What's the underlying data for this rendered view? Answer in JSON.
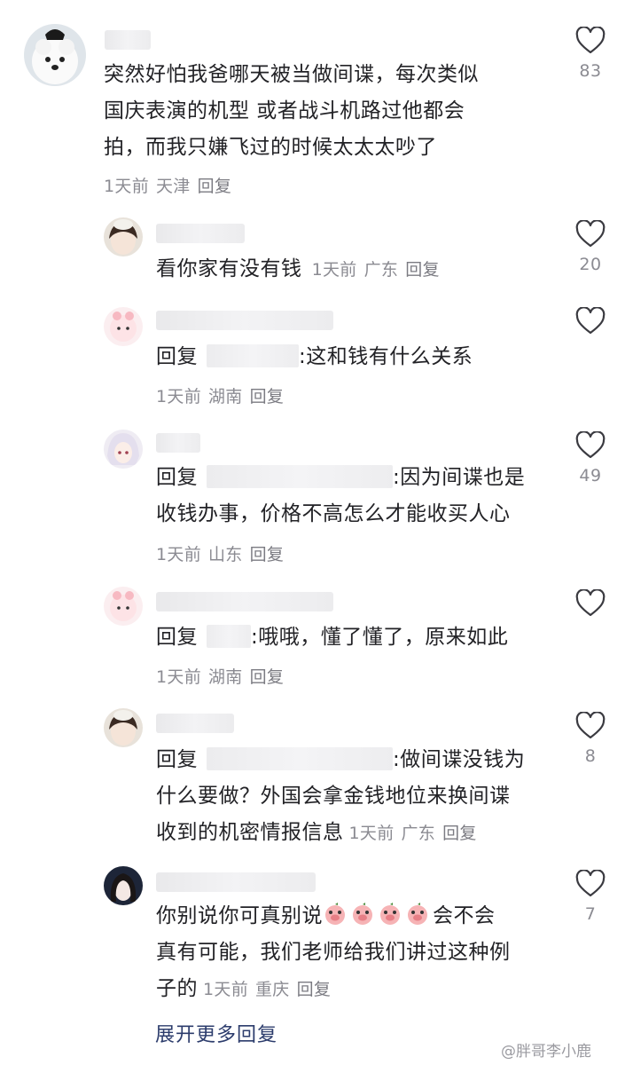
{
  "comments": [
    {
      "id": "c1",
      "body_lines": [
        "突然好怕我爸哪天被当做间谍，每次类似",
        "国庆表演的机型 或者战斗机路过他都会",
        "拍，而我只嫌飞过的时候太太太吵了"
      ],
      "time": "1天前",
      "location": "天津",
      "reply_label": "回复",
      "likes": "83"
    }
  ],
  "replies": [
    {
      "id": "r1",
      "body_lines": [
        "看你家有没有钱"
      ],
      "time": "1天前",
      "location": "广东",
      "reply_label": "回复",
      "likes": "20"
    },
    {
      "id": "r2",
      "reply_prefix": "回复",
      "body_lines": [
        ":这和钱有什么关系"
      ],
      "time": "1天前",
      "location": "湖南",
      "reply_label": "回复",
      "likes": ""
    },
    {
      "id": "r3",
      "reply_prefix": "回复",
      "body_lines": [
        ":因为间谍也是",
        "收钱办事，价格不高怎么才能收买人心"
      ],
      "time": "1天前",
      "location": "山东",
      "reply_label": "回复",
      "likes": "49"
    },
    {
      "id": "r4",
      "reply_prefix": "回复",
      "body_lines": ":哦哦，懂了懂了，原来如此",
      "time": "1天前",
      "location": "湖南",
      "reply_label": "回复",
      "likes": ""
    },
    {
      "id": "r5",
      "reply_prefix": "回复",
      "body_lines": [
        ":做间谍没钱为",
        "什么要做？外国会拿金钱地位来换间谍",
        "收到的机密情报信息"
      ],
      "time": "1天前",
      "location": "广东",
      "reply_label": "回复",
      "likes": "8"
    },
    {
      "id": "r6",
      "body_lines": [
        "你别说你可真别说",
        "会不会",
        "真有可能，我们老师给我们讲过这种例",
        "子的"
      ],
      "time": "1天前",
      "location": "重庆",
      "reply_label": "回复",
      "likes": "7"
    }
  ],
  "expand_more": "展开更多回复",
  "watermark": "@胖哥李小鹿",
  "colors": {
    "text": "#222226",
    "meta": "#8b8b92",
    "link": "#2c3c6c",
    "background": "#ffffff"
  },
  "icons": {
    "like": "heart-outline-icon",
    "emoji": "pig-face-emoji"
  }
}
